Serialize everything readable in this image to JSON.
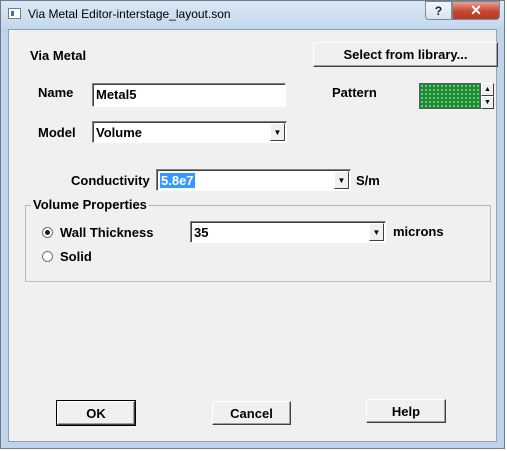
{
  "window": {
    "title": "Via Metal Editor-interstage_layout.son",
    "help_label": "?",
    "close_label": "✕"
  },
  "form": {
    "heading": "Via Metal",
    "select_library_label": "Select from library...",
    "name_label": "Name",
    "name_value": "Metal5",
    "pattern_label": "Pattern",
    "pattern_color": "#1e8b34",
    "model_label": "Model",
    "model_value": "Volume",
    "conductivity_label": "Conductivity",
    "conductivity_value": "5.8e7",
    "conductivity_unit": "S/m"
  },
  "volume_properties": {
    "title": "Volume Properties",
    "wall_thickness_label": "Wall Thickness",
    "wall_thickness_value": "35",
    "wall_thickness_unit": "microns",
    "wall_thickness_checked": true,
    "solid_label": "Solid",
    "solid_checked": false
  },
  "buttons": {
    "ok": "OK",
    "cancel": "Cancel",
    "help": "Help"
  }
}
